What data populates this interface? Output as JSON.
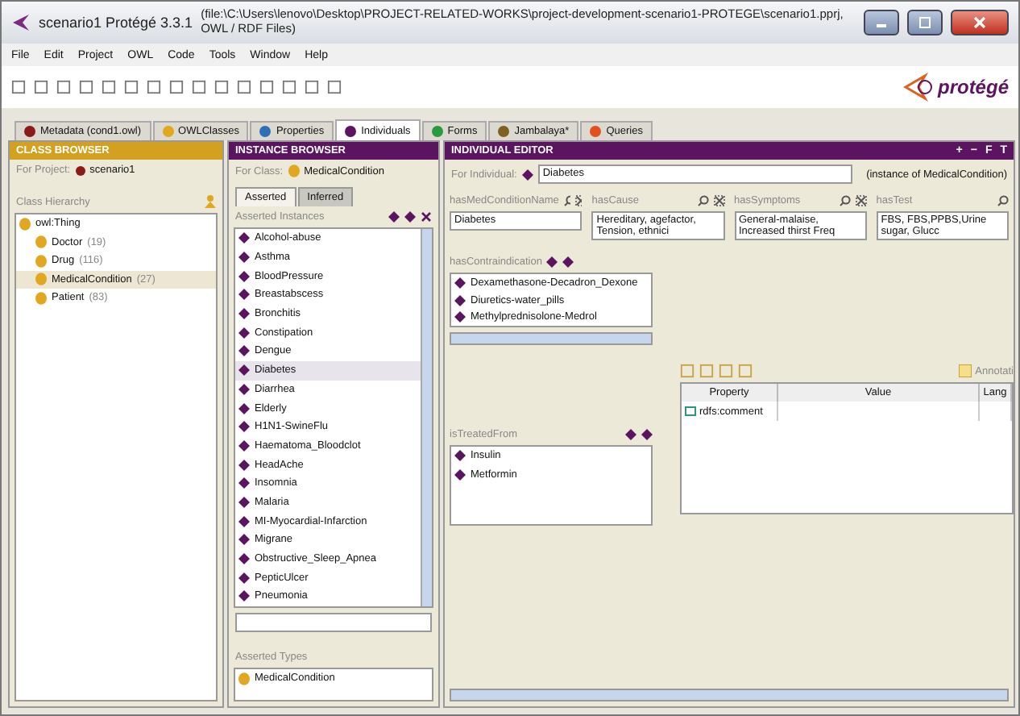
{
  "window": {
    "title": "scenario1  Protégé 3.3.1",
    "path": "(file:\\C:\\Users\\lenovo\\Desktop\\PROJECT-RELATED-WORKS\\project-development-scenario1-PROTEGE\\scenario1.pprj, OWL / RDF Files)"
  },
  "menu": [
    "File",
    "Edit",
    "Project",
    "OWL",
    "Code",
    "Tools",
    "Window",
    "Help"
  ],
  "logo": "protégé",
  "tabs": [
    {
      "label": "Metadata (cond1.owl)",
      "selected": false,
      "color": "#8b1a1a"
    },
    {
      "label": "OWLClasses",
      "selected": false,
      "color": "#e0a820"
    },
    {
      "label": "Properties",
      "selected": false,
      "color": "#2f6fb8"
    },
    {
      "label": "Individuals",
      "selected": true,
      "color": "#5a1460"
    },
    {
      "label": "Forms",
      "selected": false,
      "color": "#2a9a40"
    },
    {
      "label": "Jambalaya*",
      "selected": false,
      "color": "#806020"
    },
    {
      "label": "Queries",
      "selected": false,
      "color": "#e05020"
    }
  ],
  "class_browser": {
    "title": "CLASS BROWSER",
    "for_label": "For Project:",
    "project": "scenario1",
    "hierarchy_label": "Class Hierarchy",
    "tree": [
      {
        "label": "owl:Thing",
        "selected": false,
        "children": [
          {
            "label": "Doctor",
            "count": "(19)",
            "selected": false
          },
          {
            "label": "Drug",
            "count": "(116)",
            "selected": false
          },
          {
            "label": "MedicalCondition",
            "count": "(27)",
            "selected": true
          },
          {
            "label": "Patient",
            "count": "(83)",
            "selected": false
          }
        ]
      }
    ]
  },
  "instance_browser": {
    "title": "INSTANCE BROWSER",
    "for_label": "For Class:",
    "class": "MedicalCondition",
    "tabs": [
      {
        "label": "Asserted",
        "selected": true
      },
      {
        "label": "Inferred",
        "selected": false
      }
    ],
    "list_label": "Asserted Instances",
    "instances": [
      {
        "label": "Alcohol-abuse",
        "selected": false
      },
      {
        "label": "Asthma",
        "selected": false
      },
      {
        "label": "BloodPressure",
        "selected": false
      },
      {
        "label": "Breastabscess",
        "selected": false
      },
      {
        "label": "Bronchitis",
        "selected": false
      },
      {
        "label": "Constipation",
        "selected": false
      },
      {
        "label": "Dengue",
        "selected": false
      },
      {
        "label": "Diabetes",
        "selected": true
      },
      {
        "label": "Diarrhea",
        "selected": false
      },
      {
        "label": "Elderly",
        "selected": false
      },
      {
        "label": "H1N1-SwineFlu",
        "selected": false
      },
      {
        "label": "Haematoma_Bloodclot",
        "selected": false
      },
      {
        "label": "HeadAche",
        "selected": false
      },
      {
        "label": "Insomnia",
        "selected": false
      },
      {
        "label": "Malaria",
        "selected": false
      },
      {
        "label": "MI-Myocardial-Infarction",
        "selected": false
      },
      {
        "label": "Migrane",
        "selected": false
      },
      {
        "label": "Obstructive_Sleep_Apnea",
        "selected": false
      },
      {
        "label": "PepticUlcer",
        "selected": false
      },
      {
        "label": "Pneumonia",
        "selected": false
      }
    ],
    "types_label": "Asserted Types",
    "types": [
      "MedicalCondition"
    ]
  },
  "individual_editor": {
    "title": "INDIVIDUAL EDITOR",
    "header_buttons": [
      "+",
      "−",
      "F",
      "T"
    ],
    "for_label": "For Individual:",
    "individual": "Diabetes",
    "instance_of": "(instance of MedicalCondition)",
    "fields": [
      {
        "label": "hasMedConditionName",
        "value": "Diabetes",
        "removable": true
      },
      {
        "label": "hasCause",
        "value": "Hereditary, agefactor, Tension, ethnici",
        "removable": true
      },
      {
        "label": "hasSymptoms",
        "value": "General-malaise, Increased thirst Freq",
        "removable": true
      },
      {
        "label": "hasTest",
        "value": "FBS, FBS,PPBS,Urine sugar, Glucc",
        "removable": false
      }
    ],
    "contraindication": {
      "label": "hasContraindication",
      "items": [
        "Dexamethasone-Decadron_Dexone",
        "Diuretics-water_pills",
        "Methylprednisolone-Medrol"
      ]
    },
    "treated_from": {
      "label": "isTreatedFrom",
      "items": [
        "Insulin",
        "Metformin"
      ]
    },
    "annotations": {
      "label": "Annotati",
      "columns": [
        "Property",
        "Value",
        "Lang"
      ],
      "rows": [
        [
          "rdfs:comment",
          "",
          ""
        ]
      ]
    }
  }
}
